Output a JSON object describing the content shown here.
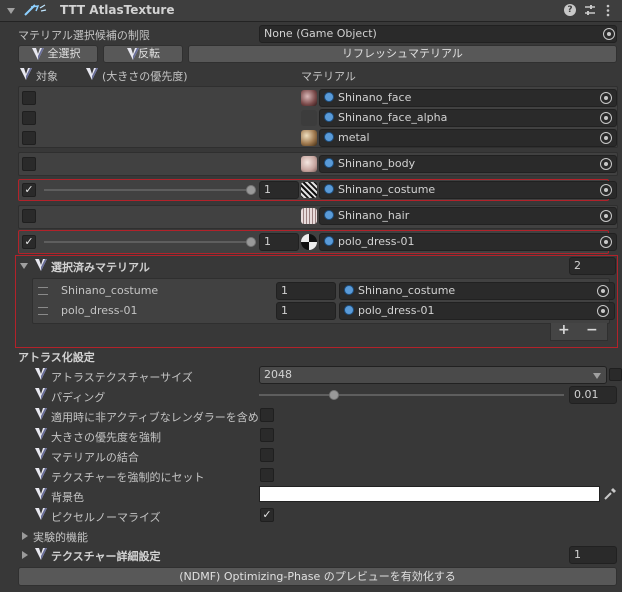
{
  "header": {
    "title": "TTT AtlasTexture"
  },
  "material_filter": {
    "label": "マテリアル選択候補の制限",
    "value": "None (Game Object)"
  },
  "toolbar": {
    "select_all": "全選択",
    "invert": "反転",
    "refresh": "リフレッシュマテリアル"
  },
  "columns": {
    "target": "対象",
    "priority": "(大きさの優先度)",
    "material": "マテリアル"
  },
  "materials": [
    {
      "name": "Shinano_face",
      "checked": false
    },
    {
      "name": "Shinano_face_alpha",
      "checked": false
    },
    {
      "name": "metal",
      "checked": false
    },
    {
      "name": "Shinano_body",
      "checked": false
    },
    {
      "name": "Shinano_costume",
      "checked": true,
      "priority": "1",
      "check_mark": "✓"
    },
    {
      "name": "Shinano_hair",
      "checked": false
    },
    {
      "name": "polo_dress-01",
      "checked": true,
      "priority": "1",
      "check_mark": "✓"
    }
  ],
  "selected": {
    "title": "選択済みマテリアル",
    "count": "2",
    "items": [
      {
        "label": "Shinano_costume",
        "value": "1",
        "material": "Shinano_costume"
      },
      {
        "label": "polo_dress-01",
        "value": "1",
        "material": "polo_dress-01"
      }
    ],
    "add": "+",
    "remove": "−"
  },
  "atlas": {
    "section_title": "アトラス化設定",
    "size_label": "アトラステクスチャーサイズ",
    "size_value": "2048",
    "padding_label": "パディング",
    "padding_value": "0.01",
    "padding_fraction": 0.25,
    "include_inactive": "適用時に非アクティブなレンダラーを含める",
    "force_priority": "大きさの優先度を強制",
    "merge_materials": "マテリアルの結合",
    "force_set_texture": "テクスチャーを強制的にセット",
    "background_color": "背景色",
    "background_color_value": "#ffffff",
    "pixel_normalize": "ピクセルノーマライズ",
    "pixel_normalize_mark": "✓"
  },
  "experimental": {
    "label": "実験的機能"
  },
  "texture_detail": {
    "label": "テクスチャー詳細設定",
    "count": "1"
  },
  "footer": {
    "preview_button": "(NDMF) Optimizing-Phase のプレビューを有効化する"
  },
  "colors": {
    "accent_red": "#b2222a",
    "vrc_icon_light": "#e8e8f0",
    "vrc_icon_dark": "#6a6f9a"
  }
}
